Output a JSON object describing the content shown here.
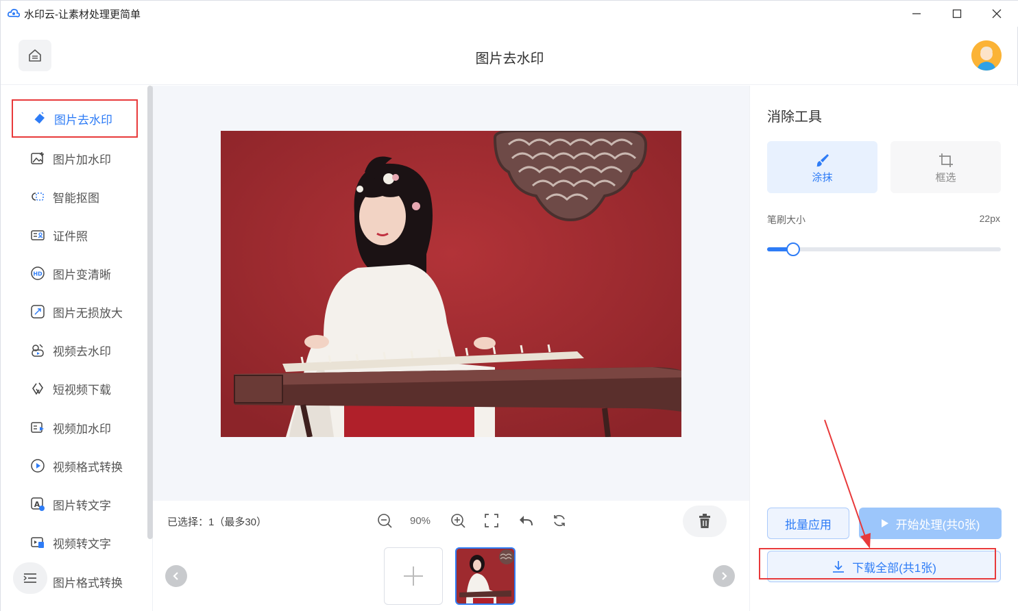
{
  "window": {
    "title": "水印云-让素材处理更简单"
  },
  "header": {
    "title": "图片去水印"
  },
  "sidebar": {
    "items": [
      {
        "label": "图片去水印",
        "icon": "eraser-icon",
        "active": true
      },
      {
        "label": "图片加水印",
        "icon": "image-add-icon"
      },
      {
        "label": "智能抠图",
        "icon": "cutout-icon"
      },
      {
        "label": "证件照",
        "icon": "id-photo-icon"
      },
      {
        "label": "图片变清晰",
        "icon": "hd-icon"
      },
      {
        "label": "图片无损放大",
        "icon": "enlarge-icon"
      },
      {
        "label": "视频去水印",
        "icon": "video-eraser-icon"
      },
      {
        "label": "短视频下载",
        "icon": "link-icon"
      },
      {
        "label": "视频加水印",
        "icon": "video-add-icon"
      },
      {
        "label": "视频格式转换",
        "icon": "play-circle-icon"
      },
      {
        "label": "图片转文字",
        "icon": "image-text-icon"
      },
      {
        "label": "视频转文字",
        "icon": "video-text-icon"
      },
      {
        "label": "图片格式转换",
        "icon": "format-icon"
      }
    ]
  },
  "toolbar": {
    "selected_text": "已选择：1（最多30）",
    "zoom": "90%"
  },
  "right_panel": {
    "title": "消除工具",
    "tools": [
      {
        "label": "涂抹",
        "icon": "brush-icon",
        "active": true
      },
      {
        "label": "框选",
        "icon": "crop-icon",
        "active": false
      }
    ],
    "brush_label": "笔刷大小",
    "brush_value": "22px",
    "brush_level": 0.11,
    "batch_label": "批量应用",
    "start_label": "开始处理(共0张)",
    "download_label": "下载全部(共1张)"
  },
  "colors": {
    "accent": "#2e7cf6",
    "highlight": "#e8393a",
    "photo_bg": "#9e2a2f"
  }
}
